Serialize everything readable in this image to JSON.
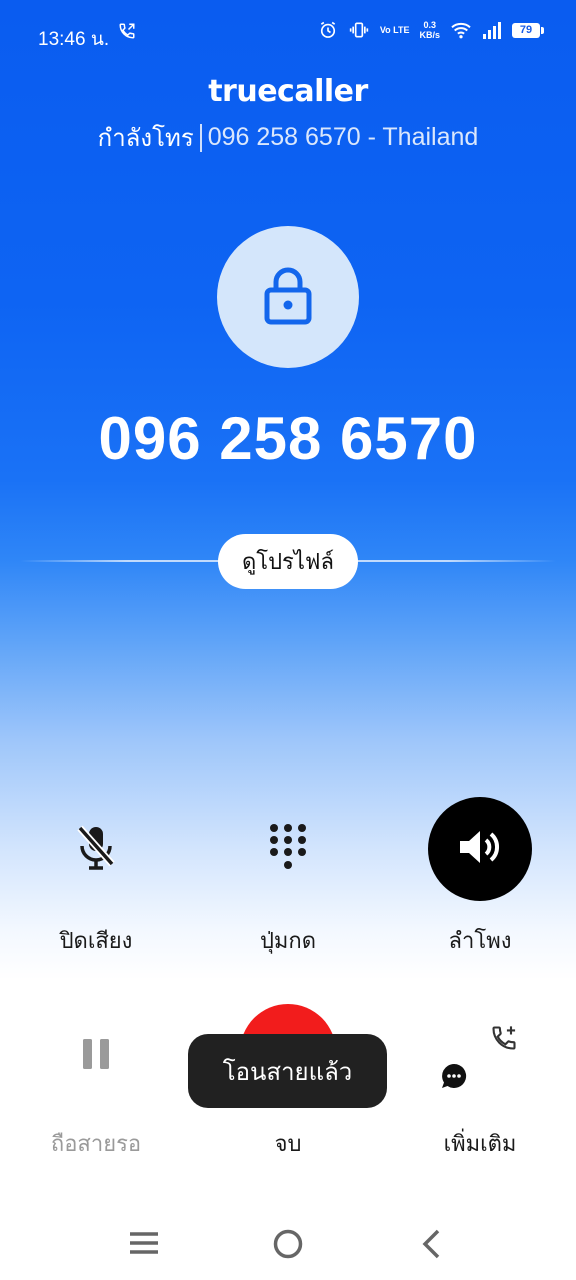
{
  "status_bar": {
    "time": "13:46 น.",
    "net_speed_value": "0.3",
    "net_speed_unit": "KB/s",
    "volte_label": "Vo LTE",
    "battery": "79"
  },
  "header": {
    "brand": "truecaller",
    "call_status": "กำลังโทร",
    "number_country": "096 258 6570 - Thailand"
  },
  "caller": {
    "avatar_icon": "lock-icon",
    "phone_number": "096 258 6570",
    "profile_button": "ดูโปรไฟล์"
  },
  "controls": {
    "mute_label": "ปิดเสียง",
    "keypad_label": "ปุ่มกด",
    "speaker_label": "ลำโพง",
    "hold_label": "ถือสายรอ",
    "end_label": "จบ",
    "more_label": "เพิ่มเติม"
  },
  "toast": {
    "message": "โอนสายแล้ว"
  },
  "colors": {
    "brand_blue": "#0a5cf0",
    "end_call_red": "#f21c1c",
    "speaker_active": "#000000"
  }
}
